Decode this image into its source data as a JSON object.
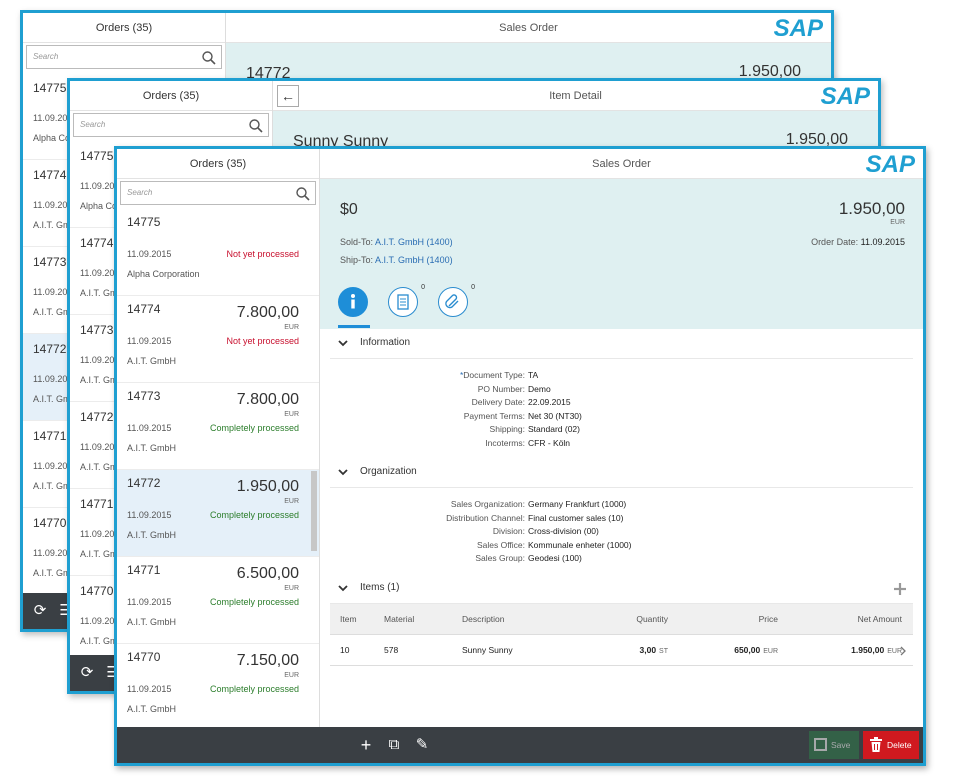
{
  "brand": "SAP",
  "back_window_1": {
    "master_title": "Orders (35)",
    "search_placeholder": "Search",
    "detail_title": "Sales Order",
    "detail_number": "14772",
    "detail_amount": "1.950,00",
    "items": [
      {
        "number": "14775",
        "date": "11.09.20",
        "customer": "Alpha Co"
      },
      {
        "number": "14774",
        "date": "11.09.20",
        "customer": "A.I.T. Gm"
      },
      {
        "number": "14773",
        "date": "11.09.20",
        "customer": "A.I.T. Gm"
      },
      {
        "number": "14772",
        "date": "11.09.20",
        "customer": "A.I.T. Gm"
      },
      {
        "number": "14771",
        "date": "11.09.20",
        "customer": "A.I.T. Gm"
      },
      {
        "number": "14770",
        "date": "11.09.20",
        "customer": "A.I.T. Gm"
      }
    ]
  },
  "back_window_2": {
    "master_title": "Orders (35)",
    "search_placeholder": "Search",
    "detail_title": "Item Detail",
    "detail_name": "Sunny Sunny",
    "detail_amount": "1.950,00",
    "items": [
      {
        "number": "14775",
        "date": "11.09.20",
        "customer": "Alpha Co"
      },
      {
        "number": "14774",
        "date": "11.09.20",
        "customer": "A.I.T. Gm"
      },
      {
        "number": "14773",
        "date": "11.09.20",
        "customer": "A.I.T. Gm"
      },
      {
        "number": "14772",
        "date": "11.09.20",
        "customer": "A.I.T. Gm"
      },
      {
        "number": "14771",
        "date": "11.09.20",
        "customer": "A.I.T. Gm"
      },
      {
        "number": "14770",
        "date": "11.09.20",
        "customer": "A.I.T. Gm"
      }
    ]
  },
  "front": {
    "master": {
      "title": "Orders (35)",
      "search_placeholder": "Search",
      "items": [
        {
          "number": "14775",
          "amount": "",
          "currency": "",
          "date": "11.09.2015",
          "status": "Not yet processed",
          "status_color": "red",
          "customer": "Alpha Corporation"
        },
        {
          "number": "14774",
          "amount": "7.800,00",
          "currency": "EUR",
          "date": "11.09.2015",
          "status": "Not yet processed",
          "status_color": "red",
          "customer": "A.I.T. GmbH"
        },
        {
          "number": "14773",
          "amount": "7.800,00",
          "currency": "EUR",
          "date": "11.09.2015",
          "status": "Completely processed",
          "status_color": "green",
          "customer": "A.I.T. GmbH"
        },
        {
          "number": "14772",
          "amount": "1.950,00",
          "currency": "EUR",
          "date": "11.09.2015",
          "status": "Completely processed",
          "status_color": "green",
          "customer": "A.I.T. GmbH",
          "selected": true
        },
        {
          "number": "14771",
          "amount": "6.500,00",
          "currency": "EUR",
          "date": "11.09.2015",
          "status": "Completely processed",
          "status_color": "green",
          "customer": "A.I.T. GmbH"
        },
        {
          "number": "14770",
          "amount": "7.150,00",
          "currency": "EUR",
          "date": "11.09.2015",
          "status": "Completely processed",
          "status_color": "green",
          "customer": "A.I.T. GmbH"
        }
      ]
    },
    "detail": {
      "title": "Sales Order",
      "object_title": "$0",
      "amount": "1.950,00",
      "currency": "EUR",
      "sold_to_label": "Sold-To:",
      "sold_to_value": "A.I.T. GmbH (1400)",
      "ship_to_label": "Ship-To:",
      "ship_to_value": "A.I.T. GmbH (1400)",
      "order_date_label": "Order Date:",
      "order_date_value": "11.09.2015",
      "tab_counts": {
        "notes": "0",
        "attachments": "0"
      },
      "sections": {
        "information": "Information",
        "organization": "Organization",
        "items": "Items (1)"
      },
      "information_fields": [
        {
          "label": "Document Type:",
          "value": "TA",
          "required": true
        },
        {
          "label": "PO Number:",
          "value": "Demo"
        },
        {
          "label": "Delivery Date:",
          "value": "22.09.2015"
        },
        {
          "label": "Payment Terms:",
          "value": "Net 30 (NT30)"
        },
        {
          "label": "Shipping:",
          "value": "Standard (02)"
        },
        {
          "label": "Incoterms:",
          "value": "CFR - Köln"
        }
      ],
      "organization_fields": [
        {
          "label": "Sales Organization:",
          "value": "Germany Frankfurt (1000)"
        },
        {
          "label": "Distribution Channel:",
          "value": "Final customer sales (10)"
        },
        {
          "label": "Division:",
          "value": "Cross-division (00)"
        },
        {
          "label": "Sales Office:",
          "value": "Kommunale enheter (1000)"
        },
        {
          "label": "Sales Group:",
          "value": "Geodesi (100)"
        }
      ],
      "items_table": {
        "columns": [
          "Item",
          "Material",
          "Description",
          "Quantity",
          "Price",
          "Net Amount"
        ],
        "rows": [
          {
            "item": "10",
            "material": "578",
            "description": "Sunny Sunny",
            "quantity": "3,00",
            "qty_unit": "ST",
            "price": "650,00",
            "price_unit": "EUR",
            "net": "1.950,00",
            "net_unit": "EUR"
          }
        ]
      },
      "footer": {
        "save": "Save",
        "delete": "Delete"
      }
    }
  }
}
